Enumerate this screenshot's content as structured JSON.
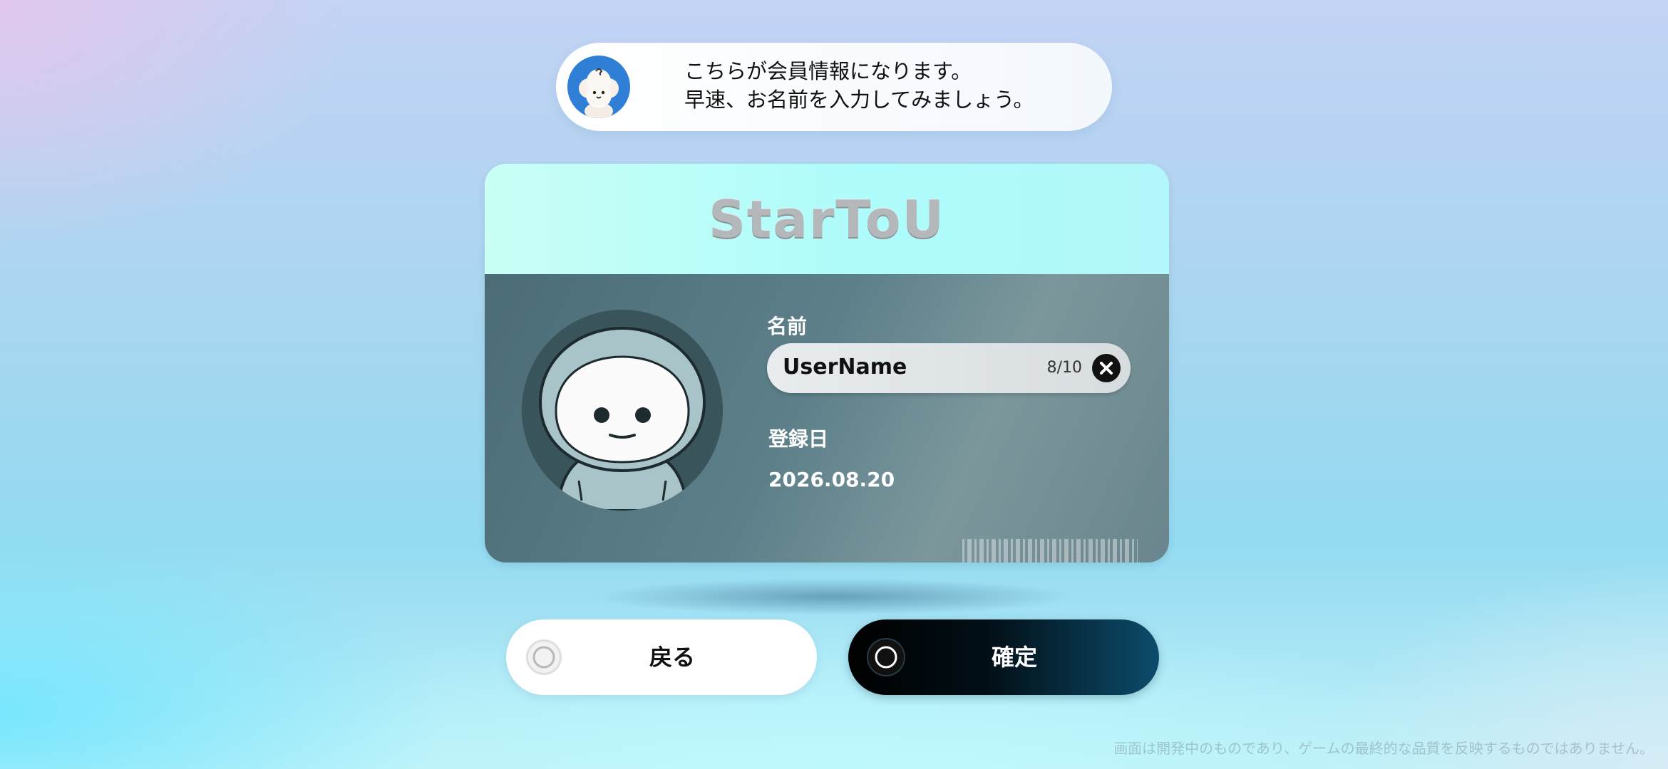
{
  "assistant_bubble": {
    "line1": "こちらが会員情報になります。",
    "line2": "早速、お名前を入力してみましょう。",
    "avatar_icon": "cloud-mascot-icon"
  },
  "card": {
    "logo": "StarToU",
    "name_label": "名前",
    "name_value": "UserName",
    "char_count": "8/10",
    "registration_label": "登録日",
    "registration_date": "2026.08.20",
    "portrait_icon": "hooded-character-avatar"
  },
  "buttons": {
    "back_label": "戻る",
    "confirm_label": "確定"
  },
  "disclaimer": "画面は開発中のものであり、ゲームの最終的な品質を反映するものではありません。",
  "colors": {
    "card_header": "#aefcfb",
    "card_body": "#5c7f89",
    "confirm_button": "#000000",
    "confirm_accent": "#0c4c6c",
    "bubble_avatar_bg": "#2f7fd6"
  }
}
